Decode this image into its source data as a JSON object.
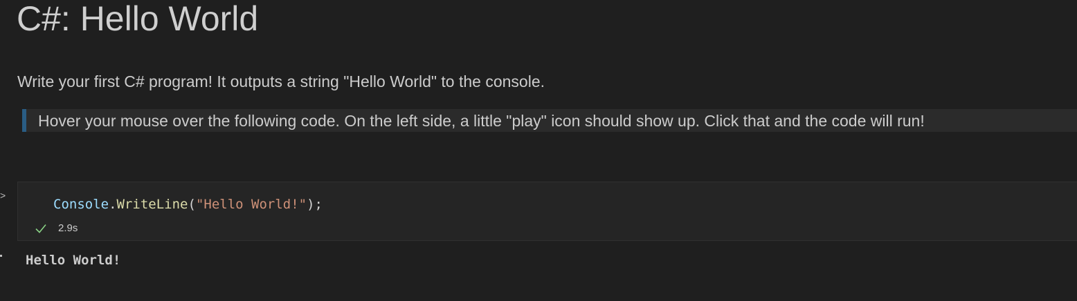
{
  "notebook": {
    "title": "C#: Hello World",
    "intro": "Write your first C# program! It outputs a string \"Hello World\" to the console.",
    "note": "Hover your mouse over the following code. On the left side, a little \"play\" icon should show up. Click that and the code will run!"
  },
  "cell": {
    "chevron": ">",
    "code_tokens": {
      "class": "Console",
      "dot": ".",
      "method": "WriteLine",
      "open": "(",
      "string": "\"Hello World!\"",
      "close": ");"
    },
    "status_icon": "check-icon",
    "duration": "2.9s",
    "status_color": "#89d185"
  },
  "output": {
    "text": "Hello World!"
  },
  "colors": {
    "background": "#1f1f1f",
    "note_accent": "#2a5d84",
    "string": "#ce9178",
    "method": "#dcdcaa",
    "identifier": "#9cdcfe"
  }
}
